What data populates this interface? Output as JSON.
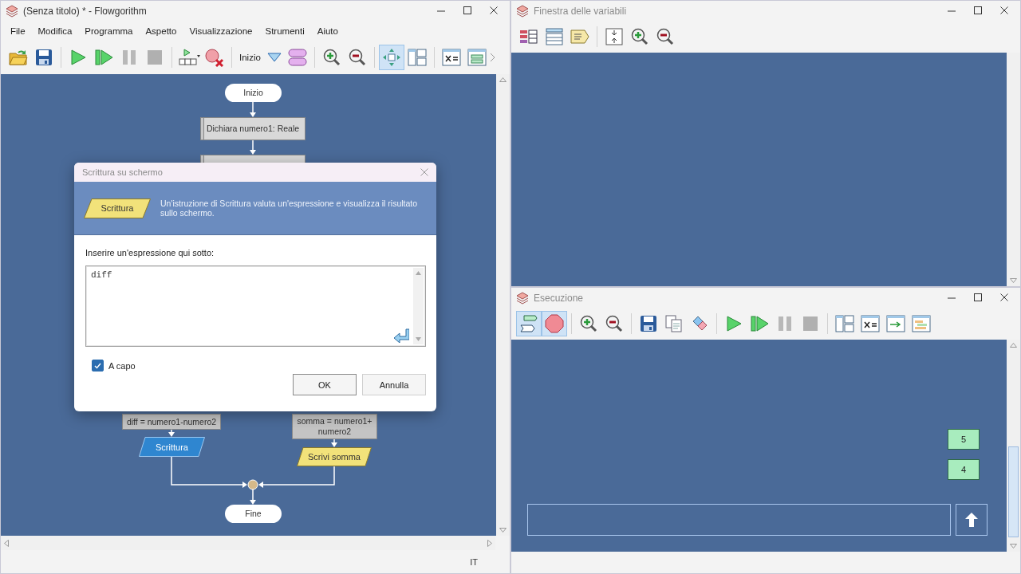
{
  "main_window": {
    "title": "(Senza titolo) * - Flowgorithm",
    "menu": [
      "File",
      "Modifica",
      "Programma",
      "Aspetto",
      "Visualizzazione",
      "Strumenti",
      "Aiuto"
    ],
    "toolbar": {
      "function_name": "Inizio",
      "view_toggles": [
        {
          "selected": true
        },
        {
          "selected": false
        }
      ]
    },
    "flowchart": {
      "nodes": [
        {
          "kind": "terminal",
          "label": "Inizio"
        },
        {
          "kind": "declare",
          "label": "Dichiara numero1: Reale"
        },
        {
          "kind": "declare"
        },
        {
          "kind": "process",
          "label": "diff = numero1-numero2"
        },
        {
          "kind": "output",
          "label": "Scrittura",
          "selected": true
        },
        {
          "kind": "process",
          "label": "somma = numero1+ numero2"
        },
        {
          "kind": "output",
          "label": "Scrivi somma",
          "selected": false
        },
        {
          "kind": "terminal",
          "label": "Fine"
        }
      ]
    },
    "status_bar": {
      "language": "IT"
    }
  },
  "dialog": {
    "title": "Scrittura su schermo",
    "shape_label": "Scrittura",
    "description": "Un'istruzione di Scrittura valuta un'espressione e visualizza il risultato sullo schermo.",
    "prompt": "Inserire un'espressione qui sotto:",
    "expression": "diff",
    "newline_checkbox": {
      "label": "A capo",
      "checked": true
    },
    "buttons": [
      {
        "label": "OK",
        "selected": true
      },
      {
        "label": "Annulla",
        "selected": false
      }
    ]
  },
  "variables_window": {
    "title": "Finestra delle variabili"
  },
  "console_window": {
    "title": "Esecuzione",
    "toolbar": {
      "mode_toggles": [
        {
          "selected": true
        },
        {
          "selected": true
        }
      ]
    },
    "outputs": [
      "5",
      "4"
    ]
  }
}
